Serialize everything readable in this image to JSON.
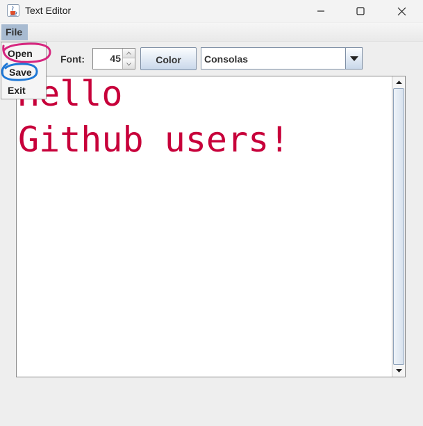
{
  "window": {
    "title": "Text Editor",
    "icon": "java-cup-icon",
    "controls": [
      "minimize-icon",
      "maximize-icon",
      "close-icon"
    ]
  },
  "menubar": {
    "file_label": "File"
  },
  "file_menu": {
    "items": [
      "Open",
      "Save",
      "Exit"
    ]
  },
  "toolbar": {
    "font_label": "Font:",
    "font_size": "45",
    "color_label": "Color",
    "font_family": "Consolas"
  },
  "editor": {
    "lines": [
      "Hello",
      "Github users!"
    ],
    "text_color": "#c7003a"
  },
  "annotations": {
    "open_circle_color": "#d6267f",
    "save_circle_color": "#1e78d6"
  }
}
